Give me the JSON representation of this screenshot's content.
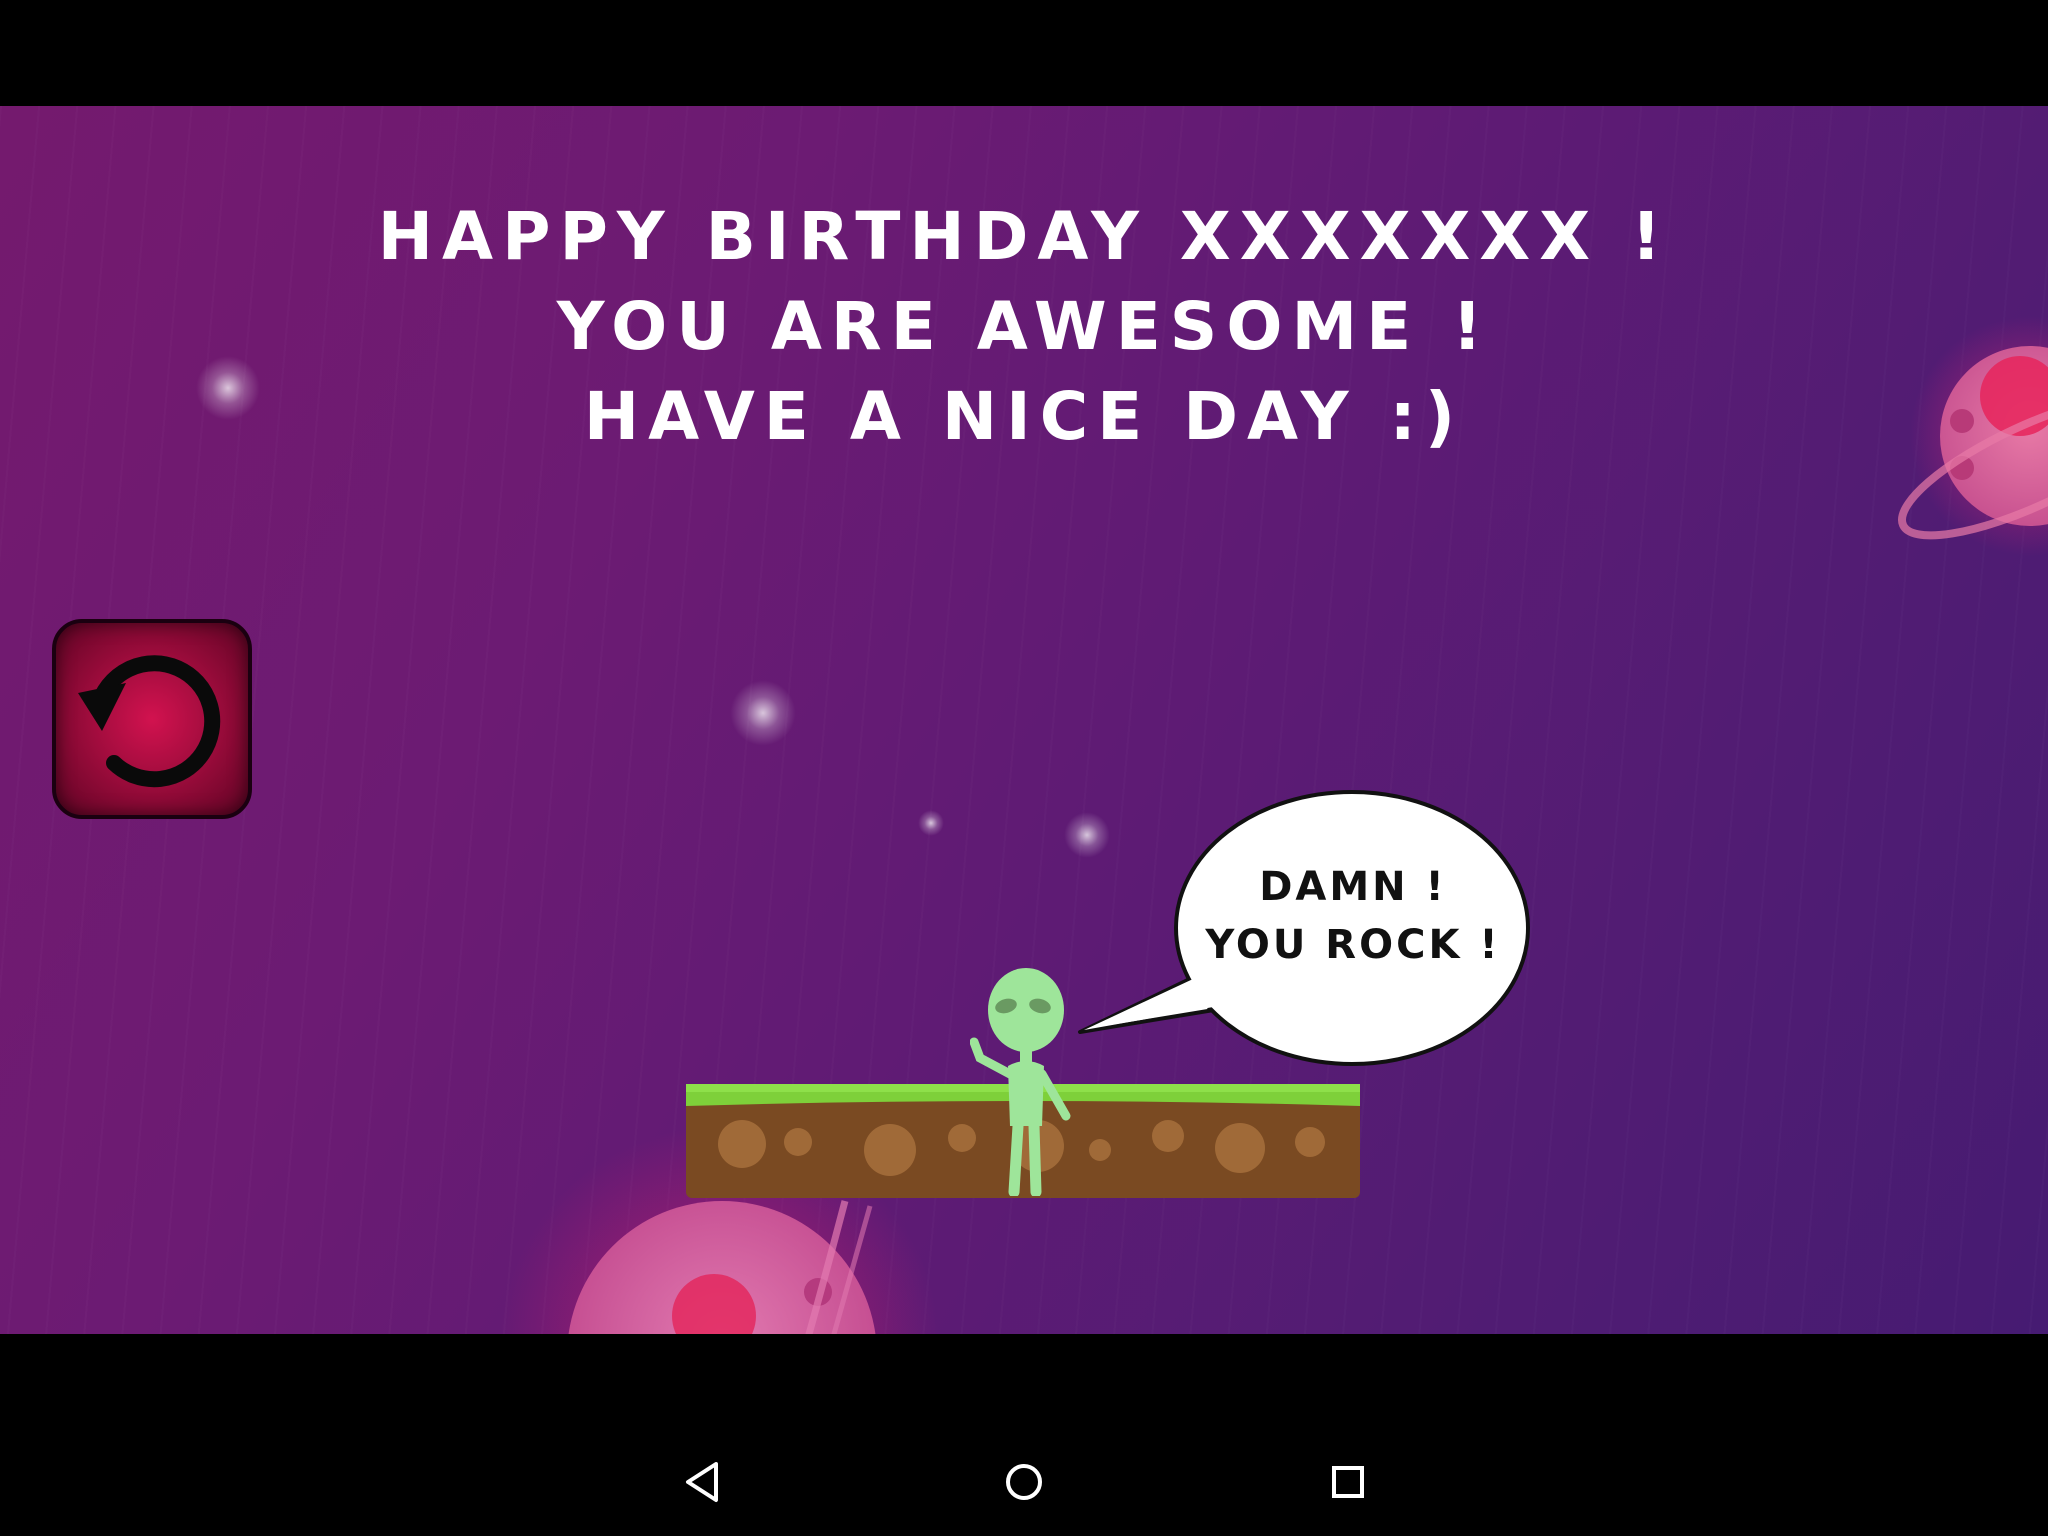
{
  "greeting": {
    "line1": "HAPPY BIRTHDAY XXXXXXX !",
    "line2": "YOU ARE AWESOME !",
    "line3": "HAVE A NICE DAY :)"
  },
  "speech_bubble": {
    "line1": "DAMN !",
    "line2": "YOU ROCK !"
  },
  "icons": {
    "restart": "restart-icon",
    "back": "back-triangle-icon",
    "home": "home-circle-icon",
    "recents": "recents-square-icon"
  },
  "colors": {
    "background_start": "#741a6e",
    "background_end": "#461b72",
    "restart_button": "#c8104a",
    "alien": "#9ee59a",
    "grass": "#7ed03a",
    "dirt": "#7a4a22",
    "planet": "#d84a8a"
  }
}
